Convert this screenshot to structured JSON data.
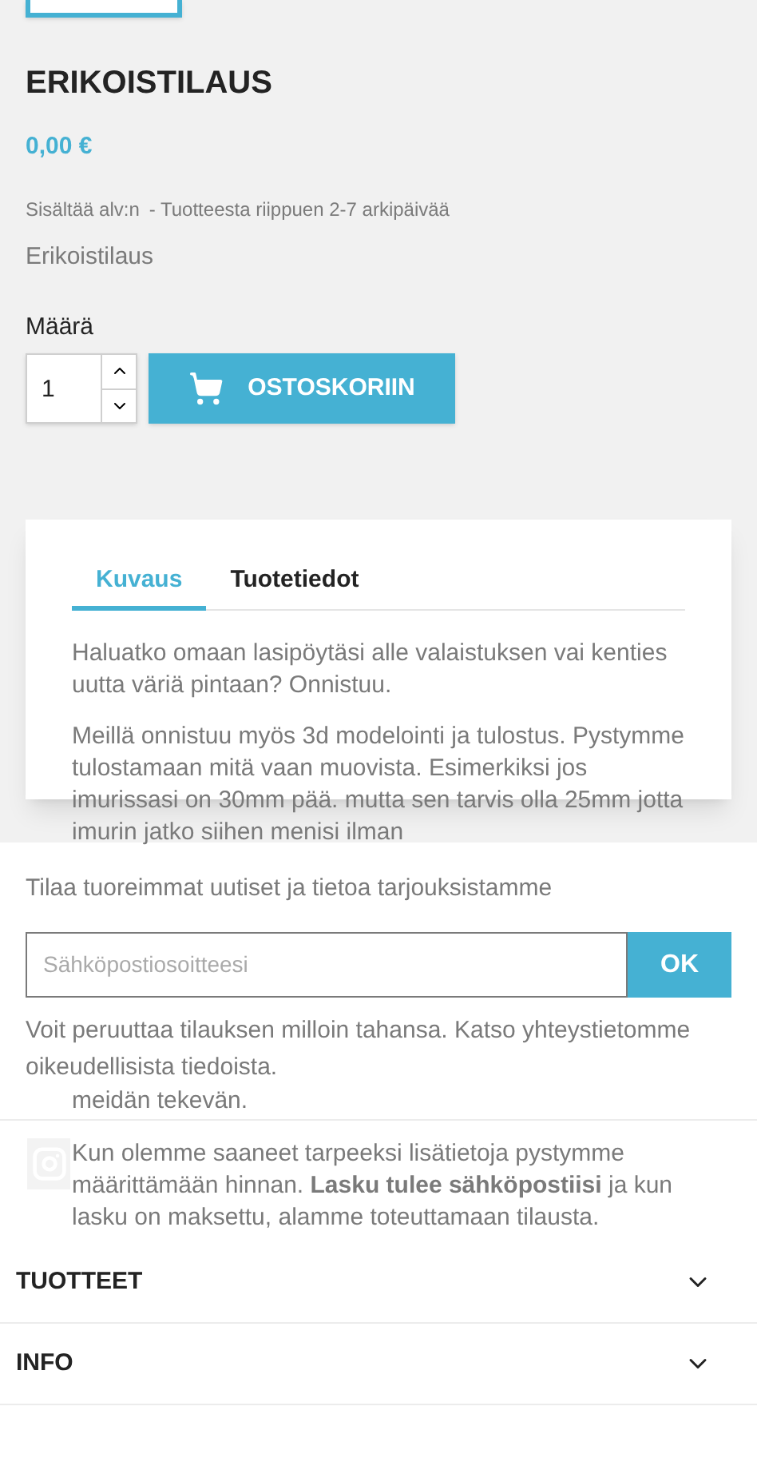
{
  "product": {
    "title": "ERIKOISTILAUS",
    "price": "0,00 €",
    "tax_note": "Sisältää alv:n",
    "delivery_note": "- Tuotteesta riippuen 2-7 arkipäivää",
    "short_description": "Erikoistilaus",
    "quantity_label": "Määrä",
    "quantity": "1",
    "add_to_cart": "OSTOSKORIIN"
  },
  "tabs": [
    {
      "label": "Kuvaus",
      "selected": true
    },
    {
      "label": "Tuotetiedot",
      "selected": false
    }
  ],
  "description": [
    "Haluatko omaan lasipöytäsi alle valaistuksen vai kenties uutta väriä pintaan? Onnistuu.",
    "Meillä onnistuu myös 3d modelointi ja tulostus. Pystymme tulostamaan mitä vaan muovista. Esimerkiksi jos imurissasi on 30mm pää. mutta sen tarvis olla 25mm jotta imurin jatko siihen menisi ilman",
    "meidän tekevän.",
    "Kun olemme saaneet tarpeeksi lisätietoja pystymme määrittämään hinnan. **Lasku tulee sähköpostiisi** ja kun lasku on maksettu, alamme toteuttamaan tilausta."
  ],
  "newsletter": {
    "title": "Tilaa tuoreimmat uutiset ja tietoa tarjouksistamme",
    "placeholder": "Sähköpostiosoitteesi",
    "button": "OK",
    "note": "Voit peruuttaa tilauksen milloin tahansa. Katso yhteystietomme oikeudellisista tiedoista."
  },
  "footer_sections": [
    {
      "label": "TUOTTEET",
      "expanded": false
    },
    {
      "label": "INFO",
      "expanded": false
    }
  ]
}
